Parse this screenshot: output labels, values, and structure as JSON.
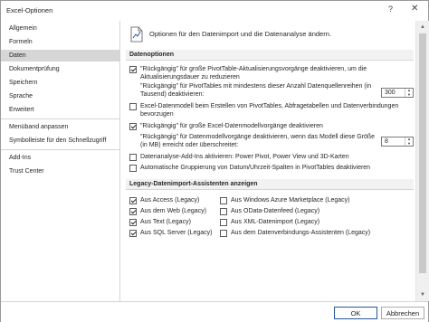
{
  "window": {
    "title": "Excel-Optionen",
    "help": "?",
    "close": "✕"
  },
  "sidebar": {
    "items": [
      {
        "label": "Allgemein"
      },
      {
        "label": "Formeln"
      },
      {
        "label": "Daten",
        "active": true
      },
      {
        "label": "Dokumentprüfung"
      },
      {
        "label": "Speichern"
      },
      {
        "label": "Sprache"
      },
      {
        "label": "Erweitert"
      },
      {
        "label": "Menüband anpassen"
      },
      {
        "label": "Symbolleiste für den Schnellzugriff"
      },
      {
        "label": "Add-Ins"
      },
      {
        "label": "Trust Center"
      }
    ]
  },
  "main": {
    "intro": "Optionen für den Datenimport und die Datenanalyse ändern.",
    "intro_icon": "data-options-icon",
    "section_data_options": "Datenoptionen",
    "opt_disable_undo_pivot_1": "\"Rückgängig\" für große PivotTable-Aktualisierungsvorgänge deaktivieren, um die",
    "opt_disable_undo_pivot_2": "Aktualisierungsdauer zu reduzieren",
    "opt_pivot_rows_1": "\"Rückgängig\" für PivotTables mit mindestens dieser Anzahl Datenquellenreihen (in",
    "opt_pivot_rows_2": "Tausend) deaktivieren:",
    "pivot_rows_value": "300",
    "opt_prefer_datamodel_1": "Excel-Datenmodell beim Erstellen von PivotTables, Abfragetabellen und Datenverbindungen",
    "opt_prefer_datamodel_2": "bevorzugen",
    "opt_disable_undo_datamodel": "\"Rückgängig\" für große Excel-Datenmodellvorgänge deaktivieren",
    "opt_datamodel_size_1": "\"Rückgängig\" für Datenmodellvorgänge deaktivieren, wenn das Modell diese Größe",
    "opt_datamodel_size_2": "(in MB) erreicht oder überschreitet:",
    "datamodel_size_value": "8",
    "opt_enable_addins": "Datenanalyse-Add-Ins aktivieren: Power Pivot, Power View und 3D-Karten",
    "opt_disable_autogroup": "Automatische Gruppierung von Datum/Uhrzeit-Spalten in PivotTables deaktivieren",
    "section_legacy": "Legacy-Datenimport-Assistenten anzeigen",
    "legacy": [
      {
        "label": "Aus Access (Legacy)",
        "checked": true
      },
      {
        "label": "Aus dem Web (Legacy)",
        "checked": true
      },
      {
        "label": "Aus Text (Legacy)",
        "checked": true
      },
      {
        "label": "Aus SQL Server (Legacy)",
        "checked": true
      },
      {
        "label": "Aus Windows Azure Marketplace (Legacy)",
        "checked": false
      },
      {
        "label": "Aus OData-Datenfeed (Legacy)",
        "checked": false
      },
      {
        "label": "Aus XML-Datenimport (Legacy)",
        "checked": false
      },
      {
        "label": "Aus dem Datenverbindungs-Assistenten (Legacy)",
        "checked": false
      }
    ]
  },
  "footer": {
    "ok_label": "OK",
    "cancel_label": "Abbrechen"
  },
  "colors": {
    "active_nav": "#d6d6d6",
    "section_bg": "#f2f2f2",
    "ok_border": "#2b579a"
  }
}
